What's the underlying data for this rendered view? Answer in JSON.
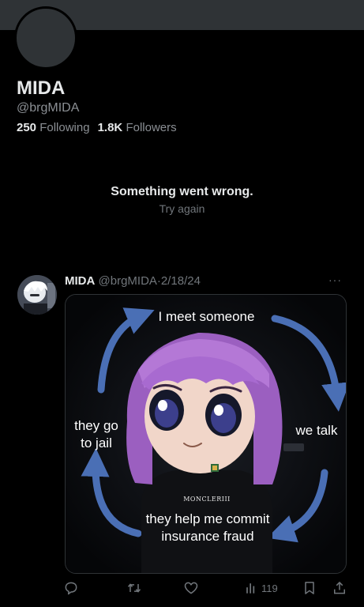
{
  "profile": {
    "display_name": "MIDA",
    "handle": "@brgMIDA",
    "following_count": "250",
    "following_label": "Following",
    "followers_count": "1.8K",
    "followers_label": "Followers"
  },
  "error": {
    "title": "Something went wrong.",
    "retry": "Try again"
  },
  "tweet": {
    "author_name": "MIDA",
    "author_handle": "@brgMIDA",
    "separator": "·",
    "date": "2/18/24",
    "more_label": "···",
    "image": {
      "text_top": "I meet someone",
      "text_left": "they go to jail",
      "text_right": "we talk",
      "text_bottom": "they help me commit insurance fraud",
      "shirt_text": "MONCLERIII"
    },
    "actions": {
      "views_count": "119"
    }
  },
  "colors": {
    "background": "#000000",
    "text_primary": "#e7e9ea",
    "text_secondary": "#71767b",
    "banner": "#2f3336",
    "arrow_blue": "#4a6fb5",
    "hair_purple": "#9b5fc0"
  }
}
